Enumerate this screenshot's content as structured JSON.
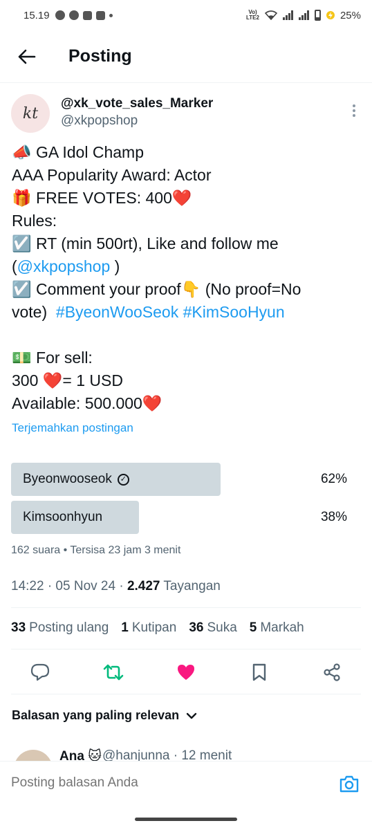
{
  "status_bar": {
    "time": "15.19",
    "volte": "Vo)\nLTE2",
    "battery": "25%"
  },
  "header": {
    "title": "Posting",
    "back_icon": "arrow-left-icon"
  },
  "author": {
    "avatar_text": "kt",
    "name": "@xk_vote_sales_Marker",
    "handle": "@xkpopshop"
  },
  "post": {
    "lines": [
      "📣 GA Idol Champ",
      "AAA Popularity Award: Actor",
      "🎁 FREE VOTES: 400❤️",
      "Rules:",
      "☑️ RT (min 500rt), Like and follow me",
      "(",
      "@xkpopshop",
      " )",
      "☑️ Comment your proof👇 (No proof=No",
      "vote)  ",
      "#ByeonWooSeok",
      " ",
      "#KimSooHyun",
      "💵 For sell:",
      "300 ❤️= 1 USD",
      "Available: 500.000❤️"
    ],
    "translate_label": "Terjemahkan postingan"
  },
  "poll": {
    "options": [
      {
        "label": "Byeonwooseok",
        "percent_text": "62%",
        "fraction": 0.62,
        "selected": true
      },
      {
        "label": "Kimsoonhyun",
        "percent_text": "38%",
        "fraction": 0.38,
        "selected": false
      }
    ],
    "meta": "162 suara • Tersisa 23 jam 3 menit"
  },
  "timestamp": {
    "time_date": "14:22 · 05 Nov 24 · ",
    "views": "2.427",
    "views_label": " Tayangan"
  },
  "stats": [
    {
      "count": "33",
      "label": "Posting ulang"
    },
    {
      "count": "1",
      "label": "Kutipan"
    },
    {
      "count": "36",
      "label": "Suka"
    },
    {
      "count": "5",
      "label": "Markah"
    }
  ],
  "actions": {
    "reply_icon": "reply-icon",
    "repost_icon": "repost-icon",
    "like_icon": "heart-icon",
    "bookmark_icon": "bookmark-icon",
    "share_icon": "share-icon",
    "repost_color": "#00ba7c",
    "like_color": "#f91880"
  },
  "replies": {
    "sort_label": "Balasan yang paling relevan",
    "first_reply": {
      "name": "Ana 🐱",
      "handle": "@hanjunna · 12 menit"
    }
  },
  "compose": {
    "placeholder": "Posting balasan Anda"
  }
}
